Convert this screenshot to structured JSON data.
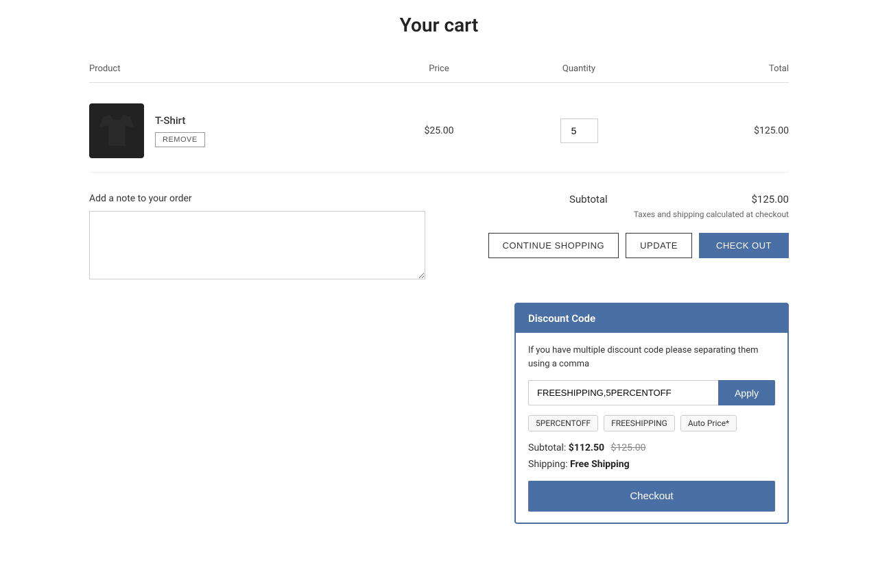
{
  "page": {
    "title": "Your cart"
  },
  "table": {
    "headers": {
      "product": "Product",
      "price": "Price",
      "quantity": "Quantity",
      "total": "Total"
    }
  },
  "cart_item": {
    "name": "T-Shirt",
    "remove_label": "REMOVE",
    "price": "$25.00",
    "quantity": 5,
    "total": "$125.00"
  },
  "note_section": {
    "label": "Add a note to your order",
    "placeholder": ""
  },
  "summary": {
    "subtotal_label": "Subtotal",
    "subtotal_value": "$125.00",
    "tax_note": "Taxes and shipping calculated at checkout"
  },
  "buttons": {
    "continue_shopping": "CONTINUE SHOPPING",
    "update": "UPDATE",
    "checkout": "CHECK OUT"
  },
  "discount_panel": {
    "title": "Discount Code",
    "note": "If you have multiple discount code please separating them using a comma",
    "input_value": "FREESHIPPING,5PERCENTOFF",
    "apply_label": "Apply",
    "tags": [
      "5PERCENTOFF",
      "FREESHIPPING",
      "Auto Price*"
    ],
    "subtotal_label": "Subtotal:",
    "subtotal_new": "$112.50",
    "subtotal_old": "$125.00",
    "shipping_label": "Shipping:",
    "shipping_value": "Free Shipping",
    "checkout_label": "Checkout"
  }
}
